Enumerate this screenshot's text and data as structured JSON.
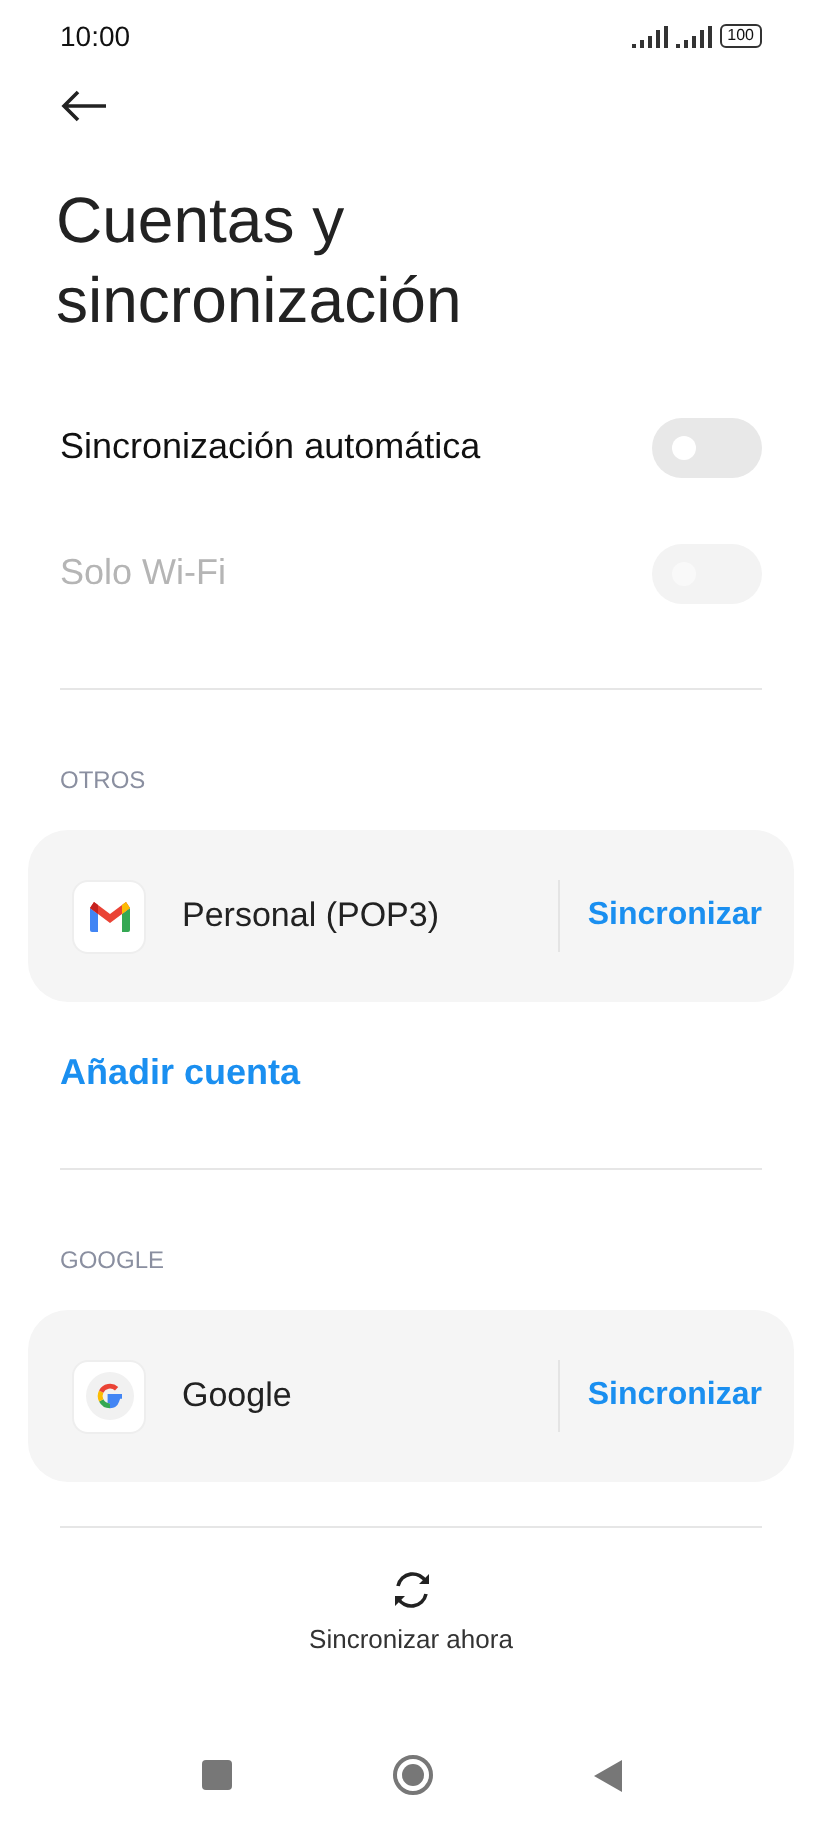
{
  "status_bar": {
    "time": "10:00",
    "battery": "100"
  },
  "title": "Cuentas y sincronización",
  "toggles": [
    {
      "label": "Sincronización automática",
      "on": false,
      "disabled": false
    },
    {
      "label": "Solo Wi-Fi",
      "on": false,
      "disabled": true
    }
  ],
  "sections": [
    {
      "heading": "OTROS",
      "accounts": [
        {
          "kind": "gmail",
          "name": "Personal (POP3)",
          "action": "Sincronizar"
        }
      ],
      "add_link": "Añadir cuenta"
    },
    {
      "heading": "GOOGLE",
      "accounts": [
        {
          "kind": "google",
          "name": "Google",
          "action": "Sincronizar"
        }
      ]
    }
  ],
  "sync_now": "Sincronizar ahora"
}
